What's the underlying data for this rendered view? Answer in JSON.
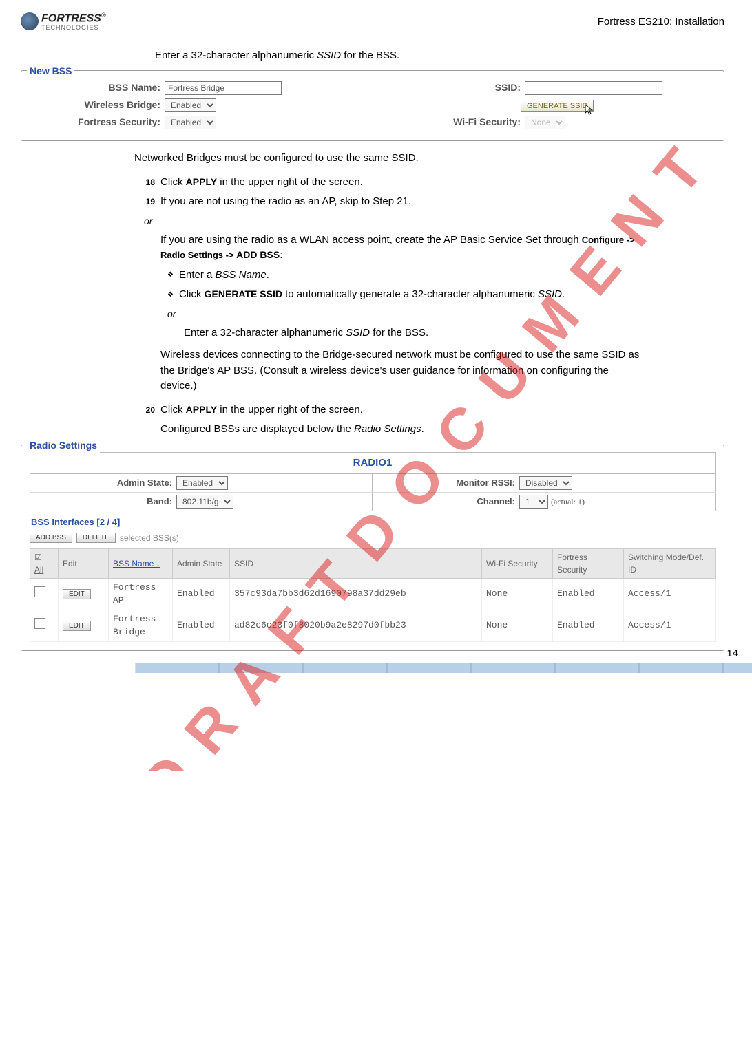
{
  "header": {
    "product": "Fortress ES210: Installation",
    "logoTop": "FORTRESS",
    "logoSub": "TECHNOLOGIES",
    "reg": "®"
  },
  "intro": {
    "t1": "Enter a 32-character alphanumeric ",
    "ssid": "SSID",
    "t2": " for the BSS."
  },
  "newbss": {
    "legend": "New BSS",
    "bssNameLbl": "BSS Name:",
    "bssNameVal": "Fortress Bridge",
    "ssidLbl": "SSID:",
    "ssidVal": "",
    "wbLbl": "Wireless Bridge:",
    "wbVal": "Enabled",
    "genBtn": "GENERATE SSID",
    "fsLbl": "Fortress Security:",
    "fsVal": "Enabled",
    "wfLbl": "Wi-Fi Security:",
    "wfVal": "None"
  },
  "body": {
    "p1": "Networked Bridges must be configured to use the same SSID.",
    "s18n": "18",
    "s18": {
      "a": "Click ",
      "apply": "APPLY",
      "b": " in the upper right of the screen."
    },
    "s19n": "19",
    "s19": "If you are not using the radio as an AP, skip to Step 21.",
    "or": "or",
    "p2a": "If you are using the radio as a WLAN access point, create the AP Basic Service Set through ",
    "cfg": "Configure",
    "arrow": " -> ",
    "radio": "Radio Settings",
    "addbss": "ADD BSS",
    "colon": ":",
    "b1a": "Enter a ",
    "b1b": "BSS Name",
    "b1c": ".",
    "b2a": "Click ",
    "b2b": "GENERATE SSID",
    "b2c": " to automatically generate a 32-character alphanumeric ",
    "b2d": "SSID",
    "b2e": ".",
    "b3a": "Enter a 32-character alphanumeric ",
    "b3b": "SSID",
    "b3c": " for the BSS.",
    "p3": "Wireless devices connecting to the Bridge-secured network must be configured to use the same SSID as the Bridge's AP BSS. (Consult a wireless device's user guidance for information on configuring the device.)",
    "s20n": "20",
    "s20": {
      "a": "Click ",
      "apply": "APPLY",
      "b": " in the upper right of the screen."
    },
    "p4a": "Configured BSSs are displayed below the ",
    "p4b": "Radio Settings",
    "p4c": "."
  },
  "radio": {
    "legend": "Radio Settings",
    "title": "RADIO1",
    "adminLbl": "Admin State:",
    "adminVal": "Enabled",
    "rssiLbl": "Monitor RSSI:",
    "rssiVal": "Disabled",
    "bandLbl": "Band:",
    "bandVal": "802.11b/g",
    "chanLbl": "Channel:",
    "chanVal": "1",
    "chanAct": "(actual: 1)",
    "bssHdr": "BSS Interfaces [2 / 4]",
    "addBtn": "ADD BSS",
    "delBtn": "DELETE",
    "selTxt": "selected BSS(s)",
    "cols": {
      "all": "All",
      "edit": "Edit",
      "name": "BSS Name",
      "admin": "Admin State",
      "ssid": "SSID",
      "wifi": "Wi-Fi Security",
      "fort": "Fortress Security",
      "sw": "Switching Mode/Def. ID"
    },
    "rows": [
      {
        "name": "Fortress AP",
        "admin": "Enabled",
        "ssid": "357c93da7bb3d62d1690798a37dd29eb",
        "wifi": "None",
        "fort": "Enabled",
        "sw": "Access/1"
      },
      {
        "name": "Fortress Bridge",
        "admin": "Enabled",
        "ssid": "ad82c6c23f0f8020b9a2e8297d0fbb23",
        "wifi": "None",
        "fort": "Enabled",
        "sw": "Access/1"
      }
    ],
    "editBtn": "EDIT"
  },
  "pageNo": "14",
  "watermark": "D R A F T   D O C U M E N T"
}
